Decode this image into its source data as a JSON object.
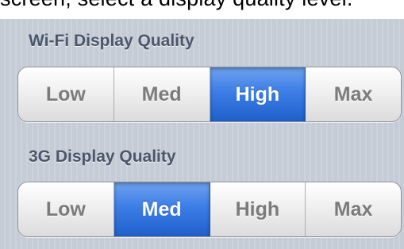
{
  "instruction_text": "screen, select a display quality level.",
  "wifi": {
    "label": "Wi-Fi Display Quality",
    "options": [
      "Low",
      "Med",
      "High",
      "Max"
    ],
    "selected": "High"
  },
  "cellular": {
    "label": "3G Display Quality",
    "options": [
      "Low",
      "Med",
      "High",
      "Max"
    ],
    "selected": "Med"
  },
  "colors": {
    "background": "#c5ccd6",
    "label_text": "#4c566a",
    "segment_text": "#7b7b7b",
    "selected_blue": "#3c7ee6"
  }
}
